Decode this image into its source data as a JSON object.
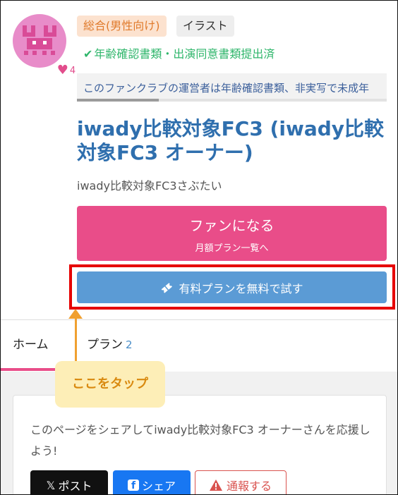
{
  "profile": {
    "avatar_icon": "crab-icon",
    "avatar_color": "#e88cc9",
    "like_count": "4"
  },
  "tags": {
    "genre": "総合(男性向け)",
    "category": "イラスト"
  },
  "verification": {
    "text": "年齢確認書類・出演同意書類提出済",
    "color": "#2fb66b"
  },
  "notice": {
    "text": "このファンクラブの運営者は年齢確認書類、非実写で未成年"
  },
  "fanclub": {
    "title": "iwady比較対象FC3 (iwady比較対象FC3 オーナー)",
    "subtitle": "iwady比較対象FC3さぶたい"
  },
  "buttons": {
    "fan_main": "ファンになる",
    "fan_sub": "月額プラン一覧へ",
    "trial": "有料プランを無料で試す"
  },
  "tabs": {
    "home": "ホーム",
    "plan": "プラン",
    "plan_count": "2"
  },
  "annotation": {
    "callout": "ここをタップ"
  },
  "share": {
    "text": "このページをシェアしてiwady比較対象FC3 オーナーさんを応援しよう!",
    "post_label": "ポスト",
    "share_label": "シェア",
    "report_label": "通報する"
  },
  "colors": {
    "accent_pink": "#e94d89",
    "trial_blue": "#5b9bd5",
    "highlight_red": "#e60000",
    "callout_orange": "#f0a030"
  }
}
